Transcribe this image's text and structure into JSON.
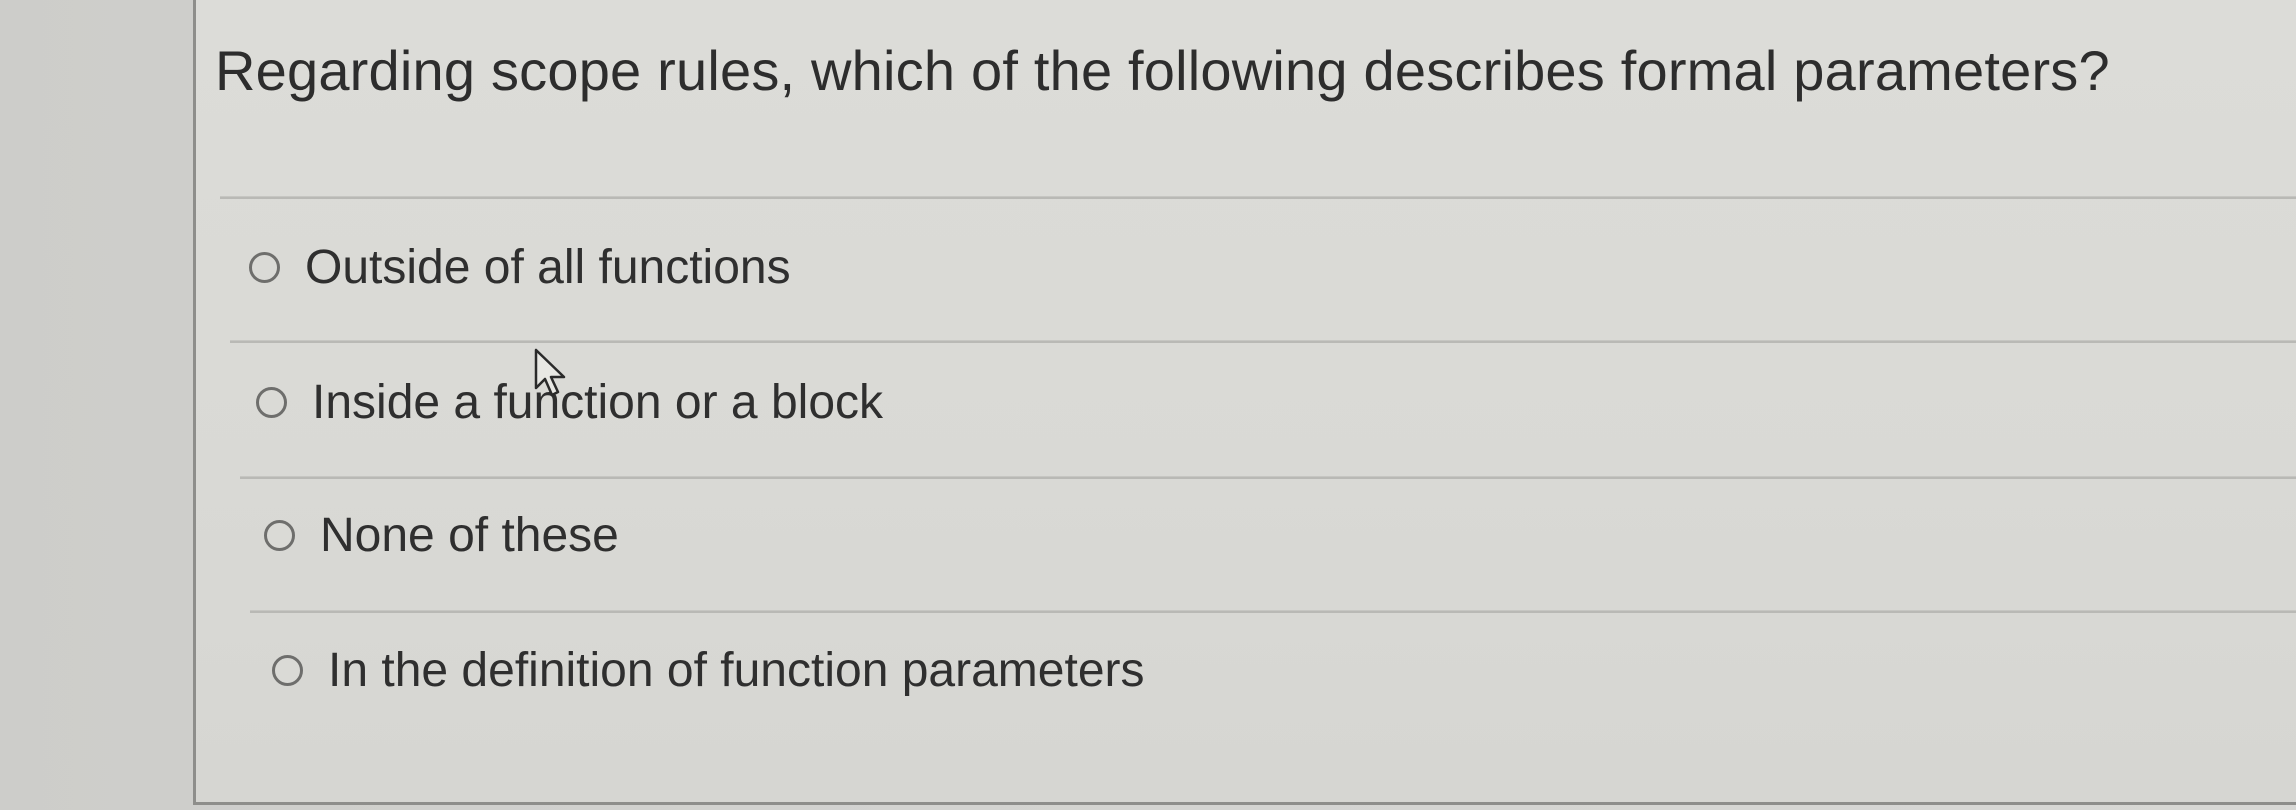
{
  "question": {
    "text": "Regarding scope rules, which of the following describes formal parameters?"
  },
  "options": [
    {
      "label": "Outside of all functions",
      "selected": false
    },
    {
      "label": "Inside a function or a block",
      "selected": false
    },
    {
      "label": "None of these",
      "selected": false
    },
    {
      "label": "In the definition of function parameters",
      "selected": false
    }
  ],
  "colors": {
    "text": "#2d2d2d",
    "radio_border": "#6e6e6c",
    "divider": "#b9b9b5"
  },
  "icons": {
    "cursor": "arrow-cursor-icon",
    "radio": "radio-button-icon"
  }
}
